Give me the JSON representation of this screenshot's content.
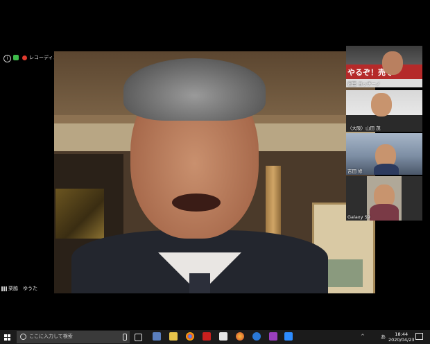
{
  "meeting": {
    "recording_text": "レコーディングしています",
    "active_speaker_name": "栗脇　ゆうた"
  },
  "gallery": [
    {
      "label": "岩田 ヨッチーノ",
      "banner": "やるぞ！売ぞ"
    },
    {
      "label": "（大阪）山田 茂"
    },
    {
      "label": "吉田 修"
    },
    {
      "label": "Galaxy S9"
    }
  ],
  "taskbar": {
    "search_placeholder": "ここに入力して検索",
    "time": "18:44",
    "date": "2020/04/23",
    "ime": "あ"
  }
}
